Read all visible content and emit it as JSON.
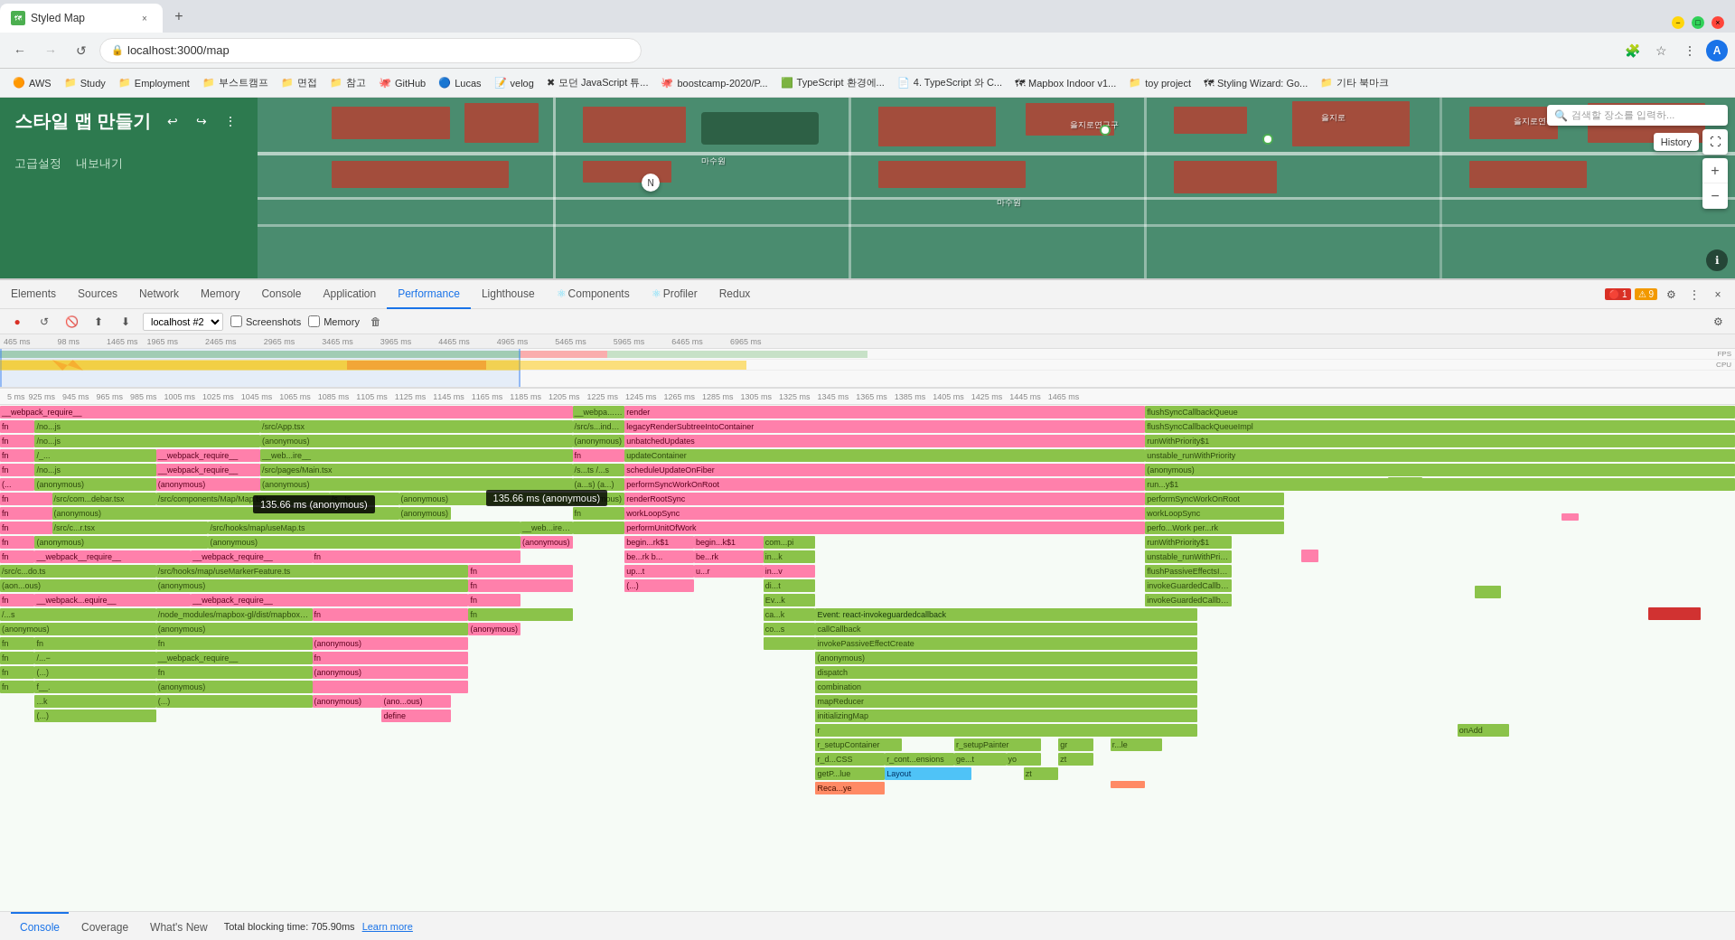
{
  "browser": {
    "tab_title": "Styled Map",
    "tab_favicon": "🗺",
    "url": "localhost:3000/map",
    "new_tab_icon": "+",
    "window_minimize": "−",
    "window_maximize": "□",
    "window_close": "×"
  },
  "bookmarks": [
    {
      "label": "AWS",
      "icon": "🟠"
    },
    {
      "label": "Study",
      "icon": "📁"
    },
    {
      "label": "Employment",
      "icon": "📁"
    },
    {
      "label": "부스트캠프",
      "icon": "📁"
    },
    {
      "label": "면접",
      "icon": "📁"
    },
    {
      "label": "참고",
      "icon": "📁"
    },
    {
      "label": "GitHub",
      "icon": "🐙"
    },
    {
      "label": "Lucas",
      "icon": "🔵"
    },
    {
      "label": "velog",
      "icon": "📝"
    },
    {
      "label": "모던 JavaScript 튜...",
      "icon": "✖"
    },
    {
      "label": "boostcamp-2020/P...",
      "icon": "🐙"
    },
    {
      "label": "TypeScript 환경에...",
      "icon": "🟩"
    },
    {
      "label": "4. TypeScript 와 C...",
      "icon": "📄"
    },
    {
      "label": "Mapbox Indoor v1...",
      "icon": "🗺"
    },
    {
      "label": "toy project",
      "icon": "📁"
    },
    {
      "label": "Styling Wizard: Go...",
      "icon": "🗺"
    },
    {
      "label": "기타 북마크",
      "icon": "📁"
    }
  ],
  "app": {
    "title": "스타일 맵 만들기",
    "undo_icon": "↩",
    "redo_icon": "↪",
    "menu_icon": "⋮",
    "advanced_label": "고급설정",
    "my_map_label": "내보내기",
    "search_placeholder": "검색할 장소를 입력하...",
    "history_label": "History",
    "zoom_in": "+",
    "zoom_out": "−",
    "fullscreen": "⛶",
    "info_icon": "ℹ"
  },
  "devtools": {
    "panels": [
      "Elements",
      "Sources",
      "Network",
      "Memory",
      "Console",
      "Application",
      "Performance",
      "Lighthouse",
      "Components",
      "Profiler",
      "Redux"
    ],
    "active_panel": "Performance",
    "error_count": "1",
    "warning_count": "9",
    "recording": "●",
    "refresh": "↺",
    "clear": "🚫",
    "upload": "⬆",
    "download": "⬇",
    "instance_label": "localhost #2",
    "screenshots_label": "Screenshots",
    "memory_label": "Memory",
    "total_blocking_time": "Total blocking time: 705.90ms",
    "learn_more": "Learn more",
    "bottom_tabs": [
      "Console",
      "Coverage",
      "What's New"
    ],
    "active_bottom_tab": "Console"
  },
  "timeline": {
    "time_markers": [
      "465 ms",
      "925 ms",
      "945 ms",
      "965 ms",
      "985 ms",
      "1005 ms",
      "1025 ms",
      "1045 ms",
      "1065 ms",
      "1085 ms",
      "1105 ms",
      "1125 ms",
      "1145 ms",
      "1165 ms",
      "1185 ms",
      "1205 ms",
      "1225 ms",
      "1245 ms",
      "1265 ms",
      "1285 ms",
      "1305 ms",
      "1325 ms",
      "1345 ms",
      "1365 ms",
      "1385 ms",
      "1405 ms",
      "1425 ms",
      "1445 ms",
      "1465 ms"
    ]
  },
  "tooltip": {
    "text": "135.66 ms (anonymous)"
  },
  "flame_functions": [
    "__webpack_require__",
    "/no...js",
    "fn",
    "/no...js",
    "(_...)",
    "fn",
    "__....",
    "/...s",
    "fn",
    "__webpack_require__",
    "/src/App.tsx",
    "(anonymous)",
    "__web...ire...",
    "(anonymous)",
    "/src/pages/Main.tsx",
    "(anonymous)",
    "__...s",
    "/..._...s",
    "(a...s)",
    "(a...)",
    "/src/com...debar.tsx",
    "/src/components/Map/Map.tsx",
    "(anonymous)",
    "(anonymous)",
    "(anonymous)",
    "/src/c...r.tsx",
    "/src/hooks/map/useMap.ts",
    "__web...ire...",
    "(anonymous)",
    "__webpack_require__",
    "/src/c...do.ts",
    "/src/hooks/map/useMarkerFeature.ts",
    "(anonymous)",
    "(a...ous)",
    "__web...re...",
    "__webpack_require__",
    "/...s",
    "fn",
    "(...)",
    "fn",
    "__....",
    "__webpack_require__",
    "(anonymous)",
    "(anonymous)",
    "define",
    "render",
    "legacyRenderSubtreeIntoContainer",
    "unbatchedUpdates",
    "updateContainer",
    "scheduleUpdateOnFiber",
    "performSyncWorkOnRoot",
    "renderRootSync",
    "workLoopSync",
    "performUnitOfWork",
    "begin...rk$1",
    "be...rk",
    "up...t",
    "begin...k$1",
    "be...rk",
    "u...r",
    "(...)",
    "fn",
    "fn",
    "fn",
    "flushSyncCallbackQueue",
    "flushSyncCallbackQueueImpl",
    "runWithPriority$1",
    "unstable_runWithPriority",
    "(anonymous)",
    "run...y$1",
    "performSyncWorkOnRoot",
    "flushPassiveEffects",
    "runWithPriority$1",
    "unstable_runWithPriority",
    "flushPassiveEffectsImpl",
    "invokeGuardedCallback",
    "invokeGuardedCallbackDev",
    "dispatchEvent",
    "Event: react-invokeguardedcallback",
    "callCallback",
    "invokePassiveEffectCreate",
    "(anonymous)",
    "dispatch",
    "combination",
    "mapReducer",
    "initializingMap",
    "r",
    "r_setupContainer",
    "r_setupPainter",
    "gr",
    "r...le",
    "r_d...CSS",
    "r_cont...ensions",
    "ge...t",
    "yo",
    "zt",
    "getP...lue",
    "Layout",
    "Reca...ye"
  ]
}
